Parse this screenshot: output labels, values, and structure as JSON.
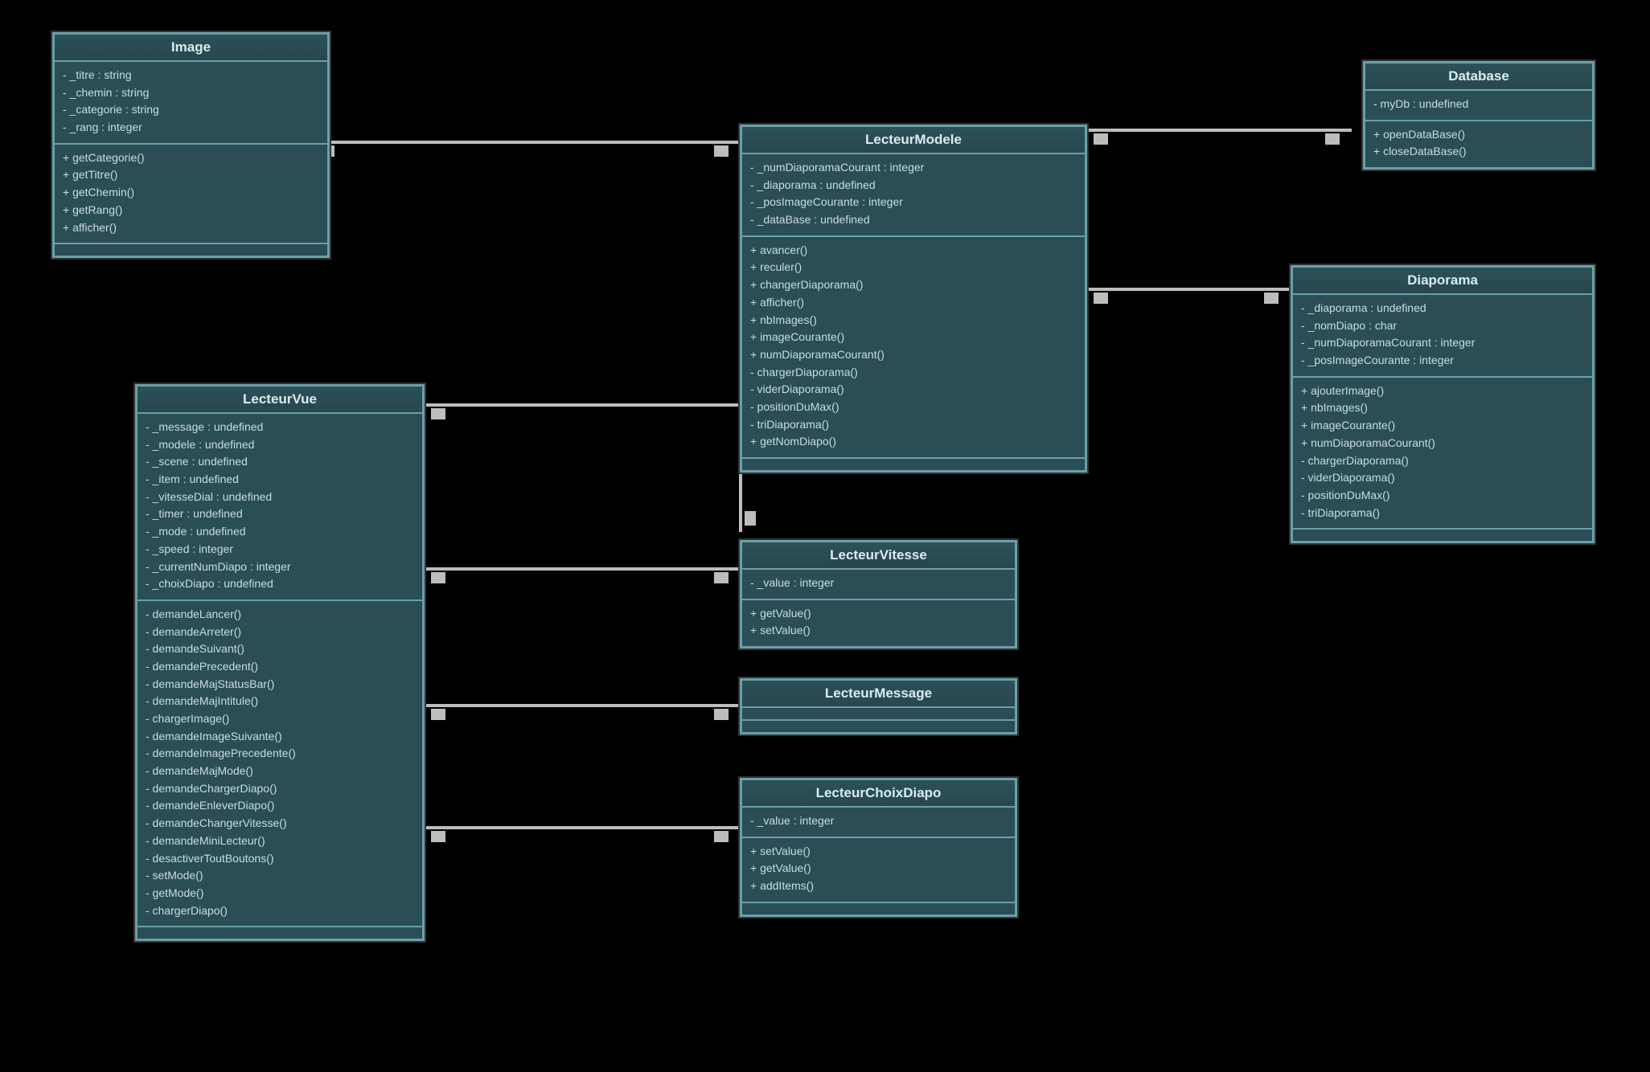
{
  "diagram": {
    "type": "uml-class-diagram",
    "classes": {
      "Image": {
        "name": "Image",
        "attributes": [
          "- _titre : string",
          "- _chemin : string",
          "- _categorie : string",
          "- _rang : integer"
        ],
        "methods": [
          "+ getCategorie()",
          "+ getTitre()",
          "+ getChemin()",
          "+ getRang()",
          "+ afficher()"
        ]
      },
      "Database": {
        "name": "Database",
        "attributes": [
          "- myDb : undefined"
        ],
        "methods": [
          "+ openDataBase()",
          "+ closeDataBase()"
        ]
      },
      "LecteurModele": {
        "name": "LecteurModele",
        "attributes": [
          "- _numDiaporamaCourant : integer",
          "- _diaporama : undefined",
          "- _posImageCourante : integer",
          "- _dataBase : undefined"
        ],
        "methods": [
          "+ avancer()",
          "+ reculer()",
          "+ changerDiaporama()",
          "+ afficher()",
          "+ nbImages()",
          "+ imageCourante()",
          "+ numDiaporamaCourant()",
          "- chargerDiaporama()",
          "- viderDiaporama()",
          "- positionDuMax()",
          "- triDiaporama()",
          "+ getNomDiapo()"
        ]
      },
      "Diaporama": {
        "name": "Diaporama",
        "attributes": [
          "- _diaporama : undefined",
          "- _nomDiapo : char",
          "- _numDiaporamaCourant : integer",
          "- _posImageCourante : integer"
        ],
        "methods": [
          "+ ajouterImage()",
          "+ nbImages()",
          "+ imageCourante()",
          "+ numDiaporamaCourant()",
          "- chargerDiaporama()",
          "- viderDiaporama()",
          "- positionDuMax()",
          "- triDiaporama()"
        ]
      },
      "LecteurVue": {
        "name": "LecteurVue",
        "attributes": [
          "- _message : undefined",
          "- _modele : undefined",
          "- _scene : undefined",
          "- _item : undefined",
          "- _vitesseDial : undefined",
          "- _timer : undefined",
          "- _mode : undefined",
          "- _speed : integer",
          "- _currentNumDiapo : integer",
          "- _choixDiapo : undefined"
        ],
        "methods": [
          "- demandeLancer()",
          "- demandeArreter()",
          "- demandeSuivant()",
          "- demandePrecedent()",
          "- demandeMajStatusBar()",
          "- demandeMajIntitule()",
          "- chargerImage()",
          "- demandeImageSuivante()",
          "- demandeImagePrecedente()",
          "- demandeMajMode()",
          "- demandeChargerDiapo()",
          "- demandeEnleverDiapo()",
          "- demandeChangerVitesse()",
          "- demandeMiniLecteur()",
          "- desactiverToutBoutons()",
          "- setMode()",
          "- getMode()",
          "- chargerDiapo()"
        ]
      },
      "LecteurVitesse": {
        "name": "LecteurVitesse",
        "attributes": [
          "- _value : integer"
        ],
        "methods": [
          "+ getValue()",
          "+ setValue()"
        ]
      },
      "LecteurMessage": {
        "name": "LecteurMessage",
        "attributes": [],
        "methods": []
      },
      "LecteurChoixDiapo": {
        "name": "LecteurChoixDiapo",
        "attributes": [
          "- _value : integer"
        ],
        "methods": [
          "+ setValue()",
          "+ getValue()",
          "+ addItems()"
        ]
      }
    },
    "associations": [
      {
        "from": "Image",
        "to": "LecteurModele"
      },
      {
        "from": "LecteurModele",
        "to": "Database"
      },
      {
        "from": "LecteurModele",
        "to": "Diaporama"
      },
      {
        "from": "LecteurVue",
        "to": "LecteurModele"
      },
      {
        "from": "LecteurVue",
        "to": "LecteurVitesse"
      },
      {
        "from": "LecteurVue",
        "to": "LecteurMessage"
      },
      {
        "from": "LecteurVue",
        "to": "LecteurChoixDiapo"
      }
    ]
  }
}
